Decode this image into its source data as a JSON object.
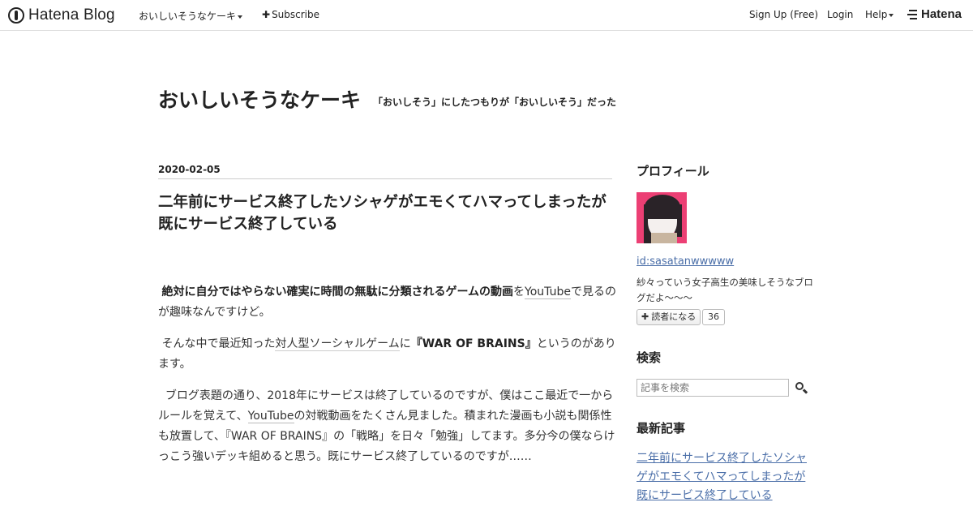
{
  "globalbar": {
    "logo_text": "Hatena Blog",
    "blog_menu": "おいしいそうなケーキ",
    "subscribe": "Subscribe",
    "signup": "Sign Up (Free)",
    "login": "Login",
    "help": "Help",
    "hatena": "Hatena"
  },
  "blog": {
    "title": "おいしいそうなケーキ",
    "description": "「おいしそう」にしたつもりが「おいしいそう」だった"
  },
  "entry": {
    "date": "2020-02-05",
    "title": "二年前にサービス終了したソシャゲがエモくてハマってしまったが既にサービス終了している",
    "p1_bold": "絶対に自分ではやらない確実に時間の無駄に分類されるゲームの動画",
    "p1_wo": "を",
    "p1_link": "YouTube",
    "p1_rest": "で見るのが趣味なんですけど。",
    "p2_a": "そんな中で最近知った",
    "p2_kw": "対人型ソーシャルゲーム",
    "p2_b": "に",
    "p2_bold": "『WAR OF BRAINS』",
    "p2_c": "というのがあります。",
    "p3_a": "ブログ表題の通り、2018年にサービスは終了しているのですが、僕はここ最近で一からルールを覚えて、",
    "p3_link": "YouTube",
    "p3_b": "の対戦動画をたくさん見ました。積まれた漫画も小説も関係性も放置して、『WAR OF BRAINS』の「戦略」を日々「勉強」してます。多分今の僕ならけっこう強いデッキ組めると思う。既にサービス終了しているのですが……"
  },
  "sidebar": {
    "profile_heading": "プロフィール",
    "profile_id": "id:sasatanwwwww",
    "profile_desc": "紗々っていう女子高生の美味しそうなブログだよ〜〜〜",
    "reader_button": "読者になる",
    "reader_count": "36",
    "search_heading": "検索",
    "search_placeholder": "記事を検索",
    "recent_heading": "最新記事",
    "recent_link": "二年前にサービス終了したソシャゲがエモくてハマってしまったが既にサービス終了している"
  }
}
